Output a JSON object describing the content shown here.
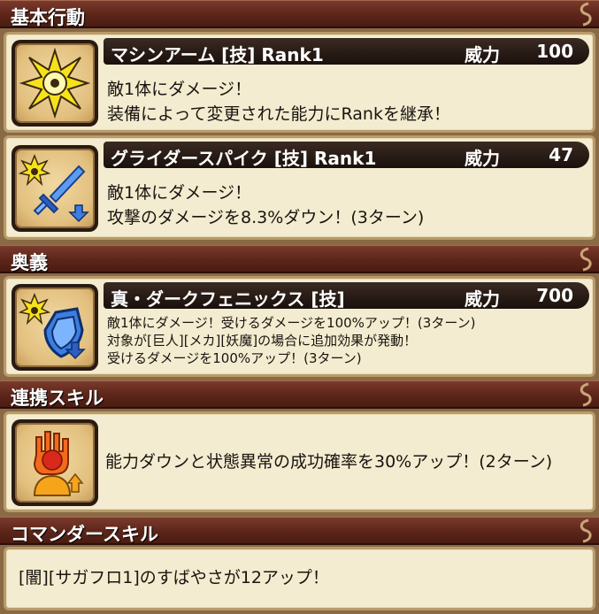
{
  "sections": {
    "basic": {
      "title": "基本行動"
    },
    "ougi": {
      "title": "奥義"
    },
    "renkei": {
      "title": "連携スキル"
    },
    "commander": {
      "title": "コマンダースキル"
    }
  },
  "skills": [
    {
      "name": "マシンアーム [技]  Rank1",
      "power_label": "威力",
      "power_value": "100",
      "icon": "burst-icon",
      "lines": [
        "敵1体にダメージ！",
        "装備によって変更された能力にRankを継承！"
      ]
    },
    {
      "name": "グライダースパイク [技]  Rank1",
      "power_label": "威力",
      "power_value": "47",
      "icon": "sword-down-icon",
      "lines": [
        "敵1体にダメージ！",
        "攻撃のダメージを8.3%ダウン！(3ターン)"
      ]
    },
    {
      "name": "真・ダークフェニックス [技]",
      "power_label": "威力",
      "power_value": "700",
      "icon": "shield-down-icon",
      "lines": [
        "敵1体にダメージ！受けるダメージを100%アップ！(3ターン)",
        "対象が[巨人][メカ][妖魔]の場合に追加効果が発動！",
        "受けるダメージを100%アップ！(3ターン)"
      ]
    }
  ],
  "renkei_skill": {
    "icon": "hand-up-icon",
    "text": "能力ダウンと状態異常の成功確率を30%アップ！(2ターン)"
  },
  "commander_skill": {
    "text": "[闇][サガフロ1]のすばやさが12アップ！"
  },
  "colors": {
    "header": "#5c2519",
    "panel": "#f3ecd0",
    "title_bar": "#1a100c",
    "burst_yellow": "#f7e21a",
    "sword_blue": "#3d7de0"
  }
}
